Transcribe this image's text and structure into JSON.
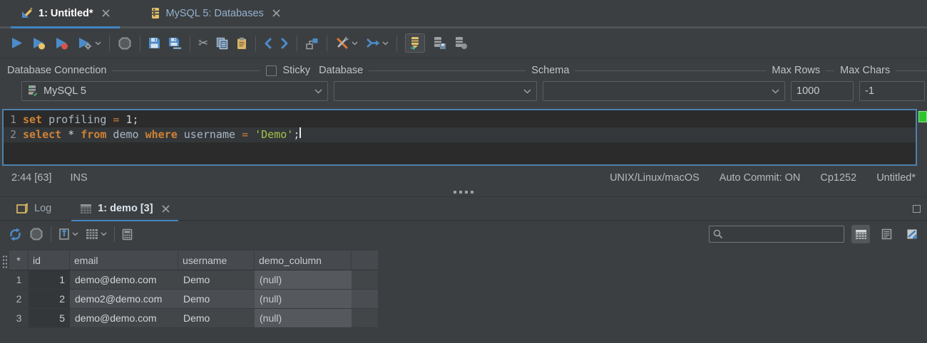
{
  "editor_tabs": [
    {
      "label": "1: Untitled*",
      "icon": "pencil-icon",
      "active": true
    },
    {
      "label": "MySQL 5: Databases",
      "icon": "database-icon",
      "active": false
    }
  ],
  "toolbar": {
    "icons": [
      "run-icon",
      "run-continue-icon",
      "run-stop-on-error-icon",
      "run-settings-icon",
      "stop-icon",
      "save-icon",
      "save-as-icon",
      "cut-icon",
      "copy-icon",
      "paste-icon",
      "back-icon",
      "forward-icon",
      "explain-plan-icon",
      "tools-icon",
      "run-script-icon",
      "database-filter-icon",
      "database-commit-icon",
      "database-rollback-icon"
    ]
  },
  "glyphs": {
    "scissors": "✂"
  },
  "connection_bar": {
    "connection_label": "Database Connection",
    "sticky_label": "Sticky",
    "database_label": "Database",
    "schema_label": "Schema",
    "max_rows_label": "Max Rows",
    "max_chars_label": "Max Chars",
    "connection_value": "MySQL 5",
    "database_value": "",
    "schema_value": "",
    "max_rows_value": "1000",
    "max_chars_value": "-1",
    "sticky_checked": false
  },
  "editor": {
    "lines": [
      {
        "number": "1",
        "current": false,
        "caret": false,
        "tokens": [
          {
            "t": "set",
            "c": "kw"
          },
          {
            "t": " profiling ",
            "c": "id"
          },
          {
            "t": "=",
            "c": "op"
          },
          {
            "t": " 1;",
            "c": "pl"
          }
        ]
      },
      {
        "number": "2",
        "current": true,
        "caret": true,
        "tokens": [
          {
            "t": "select",
            "c": "kw"
          },
          {
            "t": " * ",
            "c": "pl"
          },
          {
            "t": "from",
            "c": "kw"
          },
          {
            "t": " demo ",
            "c": "id"
          },
          {
            "t": "where",
            "c": "kw"
          },
          {
            "t": " username ",
            "c": "id"
          },
          {
            "t": "=",
            "c": "op"
          },
          {
            "t": " ",
            "c": "pl"
          },
          {
            "t": "'Demo'",
            "c": "str"
          },
          {
            "t": ";",
            "c": "pl"
          }
        ]
      }
    ]
  },
  "status_bar": {
    "position": "2:44 [63]",
    "mode": "INS",
    "line_ending": "UNIX/Linux/macOS",
    "auto_commit": "Auto Commit: ON",
    "encoding": "Cp1252",
    "file": "Untitled*"
  },
  "results_panel": {
    "tabs": [
      {
        "label": "Log",
        "icon": "log-icon",
        "active": false
      },
      {
        "label": "1: demo [3]",
        "icon": "grid-icon",
        "active": true
      }
    ],
    "toolbar_icons": [
      "refresh-icon",
      "stop-icon",
      "export-icon",
      "grid-options-icon",
      "calculator-icon"
    ],
    "search": {
      "placeholder": ""
    },
    "view_buttons": [
      "grid-view-icon",
      "text-view-icon",
      "chart-view-icon"
    ],
    "table": {
      "columns": [
        "*",
        "id",
        "email",
        "username",
        "demo_column"
      ],
      "rows": [
        {
          "row": "1",
          "id": "1",
          "email": "demo@demo.com",
          "username": "Demo",
          "demo_column": "(null)"
        },
        {
          "row": "2",
          "id": "2",
          "email": "demo2@demo.com",
          "username": "Demo",
          "demo_column": "(null)"
        },
        {
          "row": "3",
          "id": "5",
          "email": "demo@demo.com",
          "username": "Demo",
          "demo_column": "(null)"
        }
      ]
    }
  },
  "colors": {
    "accent_blue": "#4185c4",
    "editor_border": "#4e81ad",
    "keyword_orange": "#cf8234",
    "string_green": "#a5c24a",
    "marker_green": "#2ec62e",
    "panel_bg": "#3c3f41",
    "editor_bg": "#2b2b2b",
    "null_cell_bg": "#55585c"
  }
}
